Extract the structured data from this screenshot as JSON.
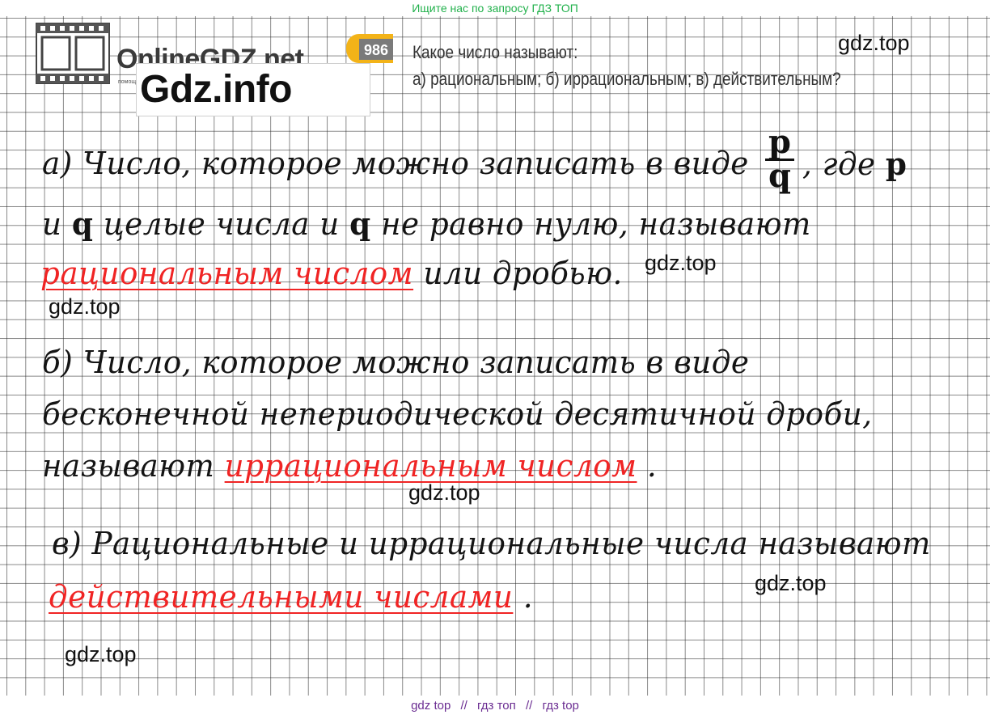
{
  "header": {
    "top_banner": "Ищите нас по запросу ГДЗ ТОП"
  },
  "logo": {
    "text": "OnlineGDZ.net",
    "sub": "помощь",
    "overlay_text": "Gdz.info"
  },
  "task": {
    "number": "986",
    "question": "Какое число называют:",
    "options": "а) рациональным;   б) иррациональным;   в) действительным?"
  },
  "watermarks": {
    "w1": "gdz.top",
    "w2": "gdz.top",
    "w3": "gdz.top",
    "w4": "gdz.top",
    "w5": "gdz.top",
    "w6": "gdz.top"
  },
  "answer": {
    "a_line1": "а) Число, которое можно записать в виде",
    "a_frac_num": "p",
    "a_frac_den": "q",
    "a_line1_end": ", где",
    "a_var_p": "p",
    "a_line2_pre": "и",
    "a_var_q1": "q",
    "a_line2_mid": "целые числа и",
    "a_var_q2": "q",
    "a_line2_end": "не равно нулю, называют",
    "a_line3_red": "рациональным числом",
    "a_line3_end": "или дробью.",
    "b_line1": "б) Число, которое можно записать в виде",
    "b_line2": "бесконечной непериодической десятичной дроби,",
    "b_line3_pre": "называют",
    "b_line3_red": "иррациональным числом",
    "b_line3_end": ".",
    "c_line1": "в) Рациональные и иррациональные числа называют",
    "c_line2_red": "действительными числами",
    "c_line2_end": "."
  },
  "footer": {
    "items": [
      "gdz top",
      "//",
      "гдз топ",
      "//",
      "гдз top"
    ]
  },
  "colors": {
    "banner_green": "#22b14c",
    "footer_purple": "#6a2c91",
    "handwriting_red": "#f02424",
    "ink": "#141414"
  }
}
